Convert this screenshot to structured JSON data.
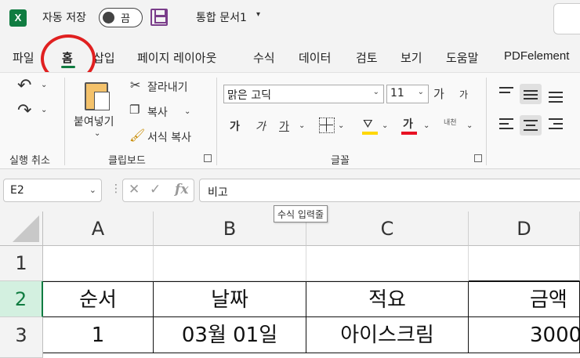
{
  "titlebar": {
    "app_icon_letter": "X",
    "autosave_label": "자동 저장",
    "autosave_state": "끔",
    "document_title": "통합 문서1",
    "title_caret": "▾"
  },
  "tabs": [
    {
      "label": "파일"
    },
    {
      "label": "홈"
    },
    {
      "label": "삽입"
    },
    {
      "label": "페이지 레이아웃"
    },
    {
      "label": "수식"
    },
    {
      "label": "데이터"
    },
    {
      "label": "검토"
    },
    {
      "label": "보기"
    },
    {
      "label": "도움말"
    },
    {
      "label": "PDFelement"
    }
  ],
  "ribbon": {
    "undo_group_label": "실행 취소",
    "clipboard_group_label": "클립보드",
    "paste_label": "붙여넣기",
    "cut_label": "잘라내기",
    "copy_label": "복사",
    "format_painter_label": "서식 복사",
    "font_group_label": "글꼴",
    "font_name": "맑은 고딕",
    "font_size": "11",
    "grow_font": "가",
    "shrink_font": "가",
    "bold": "가",
    "italic": "가",
    "underline": "가",
    "font_color_letter": "가",
    "phonetic_label": "내천",
    "font_color_hex": "#e81123",
    "highlight_color_hex": "#ffd700"
  },
  "formula_bar": {
    "name_box": "E2",
    "formula": "비고",
    "tooltip": "수식 입력줄",
    "fx_label": "fx"
  },
  "sheet": {
    "columns": [
      "A",
      "B",
      "C",
      "D"
    ],
    "rows": [
      "1",
      "2",
      "3"
    ],
    "cells": {
      "A2": "순서",
      "B2": "날짜",
      "C2": "적요",
      "D2": "금액",
      "A3": "1",
      "B3": "03월 01일",
      "C3": "아이스크림",
      "D3": "3000"
    }
  },
  "colors": {
    "excel_green": "#107c41",
    "annotation_red": "#e02020"
  }
}
